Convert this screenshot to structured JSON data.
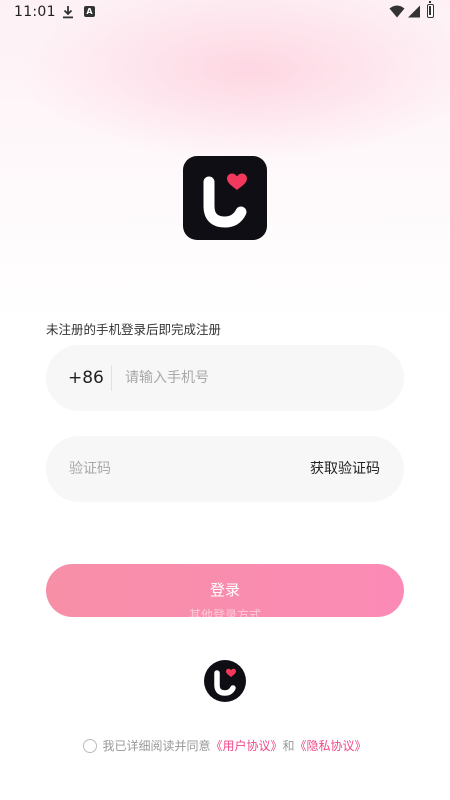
{
  "status_bar": {
    "time": "11:01",
    "icons": [
      "download-icon",
      "a-icon",
      "wifi-icon",
      "signal-icon",
      "battery-icon"
    ]
  },
  "login": {
    "hint": "未注册的手机登录后即完成注册",
    "country_code": "+86",
    "phone_placeholder": "请输入手机号",
    "phone_value": "",
    "code_placeholder": "验证码",
    "code_value": "",
    "get_code_label": "获取验证码",
    "login_label": "登录",
    "other_login_label": "其他登录方式"
  },
  "agreement": {
    "prefix": "我已详细阅读并同意",
    "user_agreement": "《用户协议》",
    "connector": "和",
    "privacy_policy": "《隐私协议》"
  },
  "colors": {
    "accent_pink": "#f0478a",
    "button_gradient_start": "#f78fa7",
    "button_gradient_end": "#fb8bb6",
    "logo_bg": "#0e0e14",
    "heart": "#f2385d"
  }
}
